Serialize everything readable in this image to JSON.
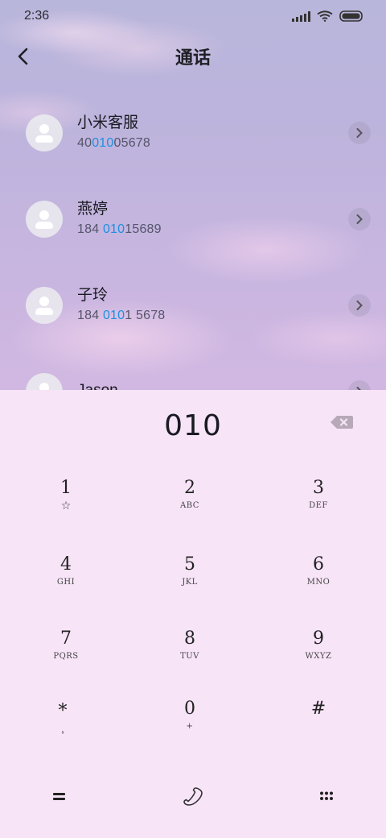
{
  "status_bar": {
    "time": "2:36"
  },
  "header": {
    "title": "通话",
    "back_icon": "chevron-left-icon"
  },
  "contacts": [
    {
      "name": "小米客服",
      "number_before": "40",
      "number_match": "010",
      "number_after": "05678"
    },
    {
      "name": "燕婷",
      "number_before": "184 ",
      "number_match": "010",
      "number_after": "15689"
    },
    {
      "name": "子玲",
      "number_before": "184 ",
      "number_match": "010",
      "number_after": "1 5678"
    },
    {
      "name": "Jason",
      "number_before": "",
      "number_match": "",
      "number_after": ""
    }
  ],
  "dialer": {
    "input": "010",
    "keys": [
      {
        "digit": "1",
        "sub": "☆"
      },
      {
        "digit": "2",
        "sub": "ABC"
      },
      {
        "digit": "3",
        "sub": "DEF"
      },
      {
        "digit": "4",
        "sub": "GHI"
      },
      {
        "digit": "5",
        "sub": "JKL"
      },
      {
        "digit": "6",
        "sub": "MNO"
      },
      {
        "digit": "7",
        "sub": "PQRS"
      },
      {
        "digit": "8",
        "sub": "TUV"
      },
      {
        "digit": "9",
        "sub": "WXYZ"
      },
      {
        "digit": "*",
        "sub": ","
      },
      {
        "digit": "0",
        "sub": "+"
      },
      {
        "digit": "#",
        "sub": ""
      }
    ]
  },
  "colors": {
    "highlight": "#1e90e0",
    "panel_bg": "#f7e4f7"
  }
}
